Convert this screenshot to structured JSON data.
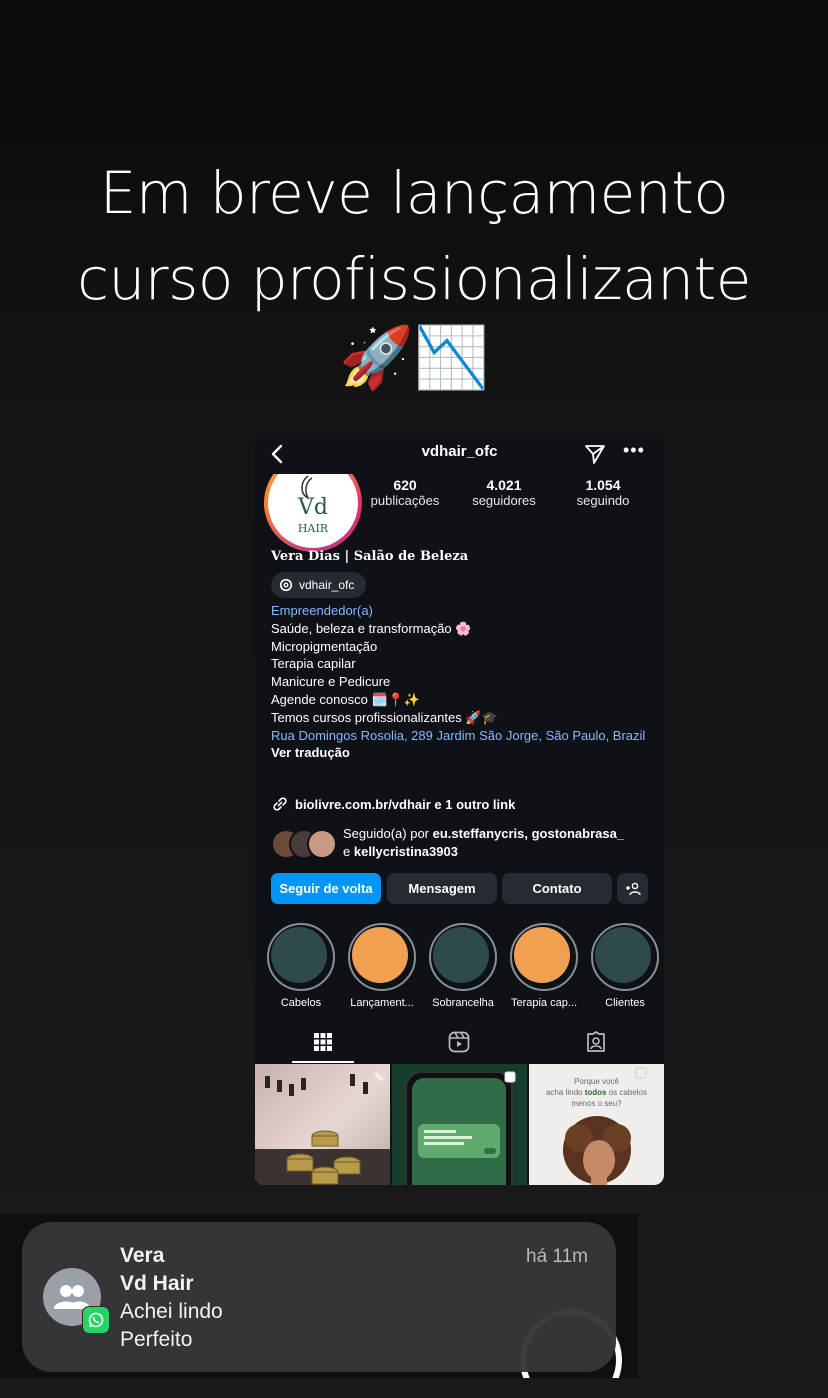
{
  "story": {
    "headline_line1": "Em breve lançamento",
    "headline_line2": "curso profissionalizante",
    "emojis": "🚀📉"
  },
  "instagram": {
    "username": "vdhair_ofc",
    "avatar_text": "VD HAIR",
    "stats": [
      {
        "value": "620",
        "label": "publicações"
      },
      {
        "value": "4.021",
        "label": "seguidores"
      },
      {
        "value": "1.054",
        "label": "seguindo"
      }
    ],
    "name": "Vera Dias | Salão de Beleza",
    "threads_handle": "vdhair_ofc",
    "bio": {
      "category": "Empreendedor(a)",
      "lines": [
        "Saúde, beleza e transformação 🌸",
        "Micropigmentação",
        "Terapia capilar",
        "Manicure e Pedicure",
        "Agende conosco 🗓️📍✨",
        "Temos cursos profissionalizantes 🚀🎓"
      ],
      "address": "Rua Domingos Rosolia, 289 Jardim São Jorge, São Paulo, Brazil",
      "translate": "Ver tradução"
    },
    "link": "biolivre.com.br/vdhair e 1 outro link",
    "followed_by": {
      "prefix": "Seguido(a) por",
      "names_line1": "eu.steffanycris, gostonabrasa_",
      "conj": "e",
      "names_line2": "kellycristina3903"
    },
    "buttons": {
      "follow_back": "Seguir de volta",
      "message": "Mensagem",
      "contact": "Contato"
    },
    "highlights": [
      {
        "label": "Cabelos",
        "color": "#2f4a4d"
      },
      {
        "label": "Lançament...",
        "color": "#f0a050"
      },
      {
        "label": "Sobrancelha",
        "color": "#2f4a4d"
      },
      {
        "label": "Terapia cap...",
        "color": "#f0a050"
      },
      {
        "label": "Clientes",
        "color": "#2f4a4d"
      }
    ],
    "grid_post3_text_a": "Porque você",
    "grid_post3_text_b": "acha lindo",
    "grid_post3_text_bold": "todos",
    "grid_post3_text_c": "os cabelos",
    "grid_post3_text_d": "menos o seu?"
  },
  "notification": {
    "sender": "Vera",
    "group": "Vd Hair",
    "message_line1": "Achei lindo",
    "message_line2": "Perfeito",
    "time": "há 11m"
  }
}
